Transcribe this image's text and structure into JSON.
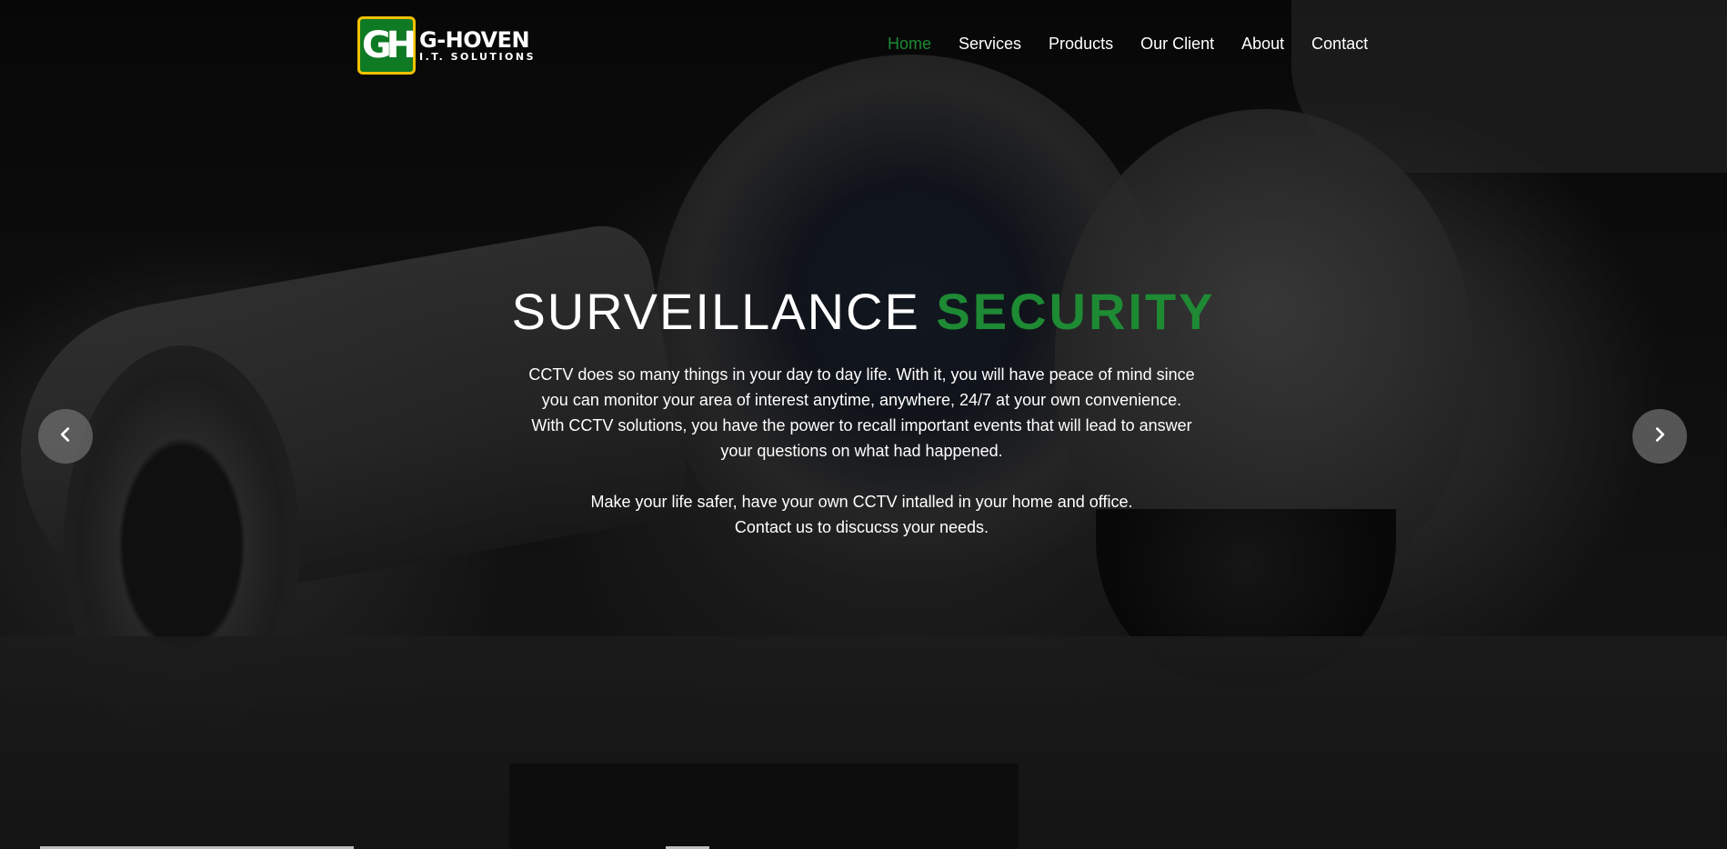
{
  "brand": {
    "logo_initials": "GH",
    "name": "G-HOVEN",
    "tagline": "I.T. SOLUTIONS"
  },
  "nav": {
    "items": [
      {
        "label": "Home",
        "active": true
      },
      {
        "label": "Services",
        "active": false
      },
      {
        "label": "Products",
        "active": false
      },
      {
        "label": "Our Client",
        "active": false
      },
      {
        "label": "About",
        "active": false
      },
      {
        "label": "Contact",
        "active": false
      }
    ]
  },
  "hero": {
    "title_light": "SURVEILLANCE",
    "title_bold": "SECURITY",
    "paragraph1": "CCTV does so many things in your day to day life. With it, you will have peace of mind since you can monitor your area of interest anytime, anywhere, 24/7 at your own convenience. With CCTV solutions, you have the power to recall important events that will lead to answer your questions on what had happened.",
    "paragraph2_line1": "Make your life safer, have your own CCTV intalled in your home and office.",
    "paragraph2_line2": "Contact us to discucss your needs."
  },
  "slider": {
    "prev_icon": "chevron-left-icon",
    "next_icon": "chevron-right-icon"
  },
  "colors": {
    "accent": "#1e8a34",
    "logo_green": "#0f7a24",
    "logo_border": "#f2c200"
  }
}
